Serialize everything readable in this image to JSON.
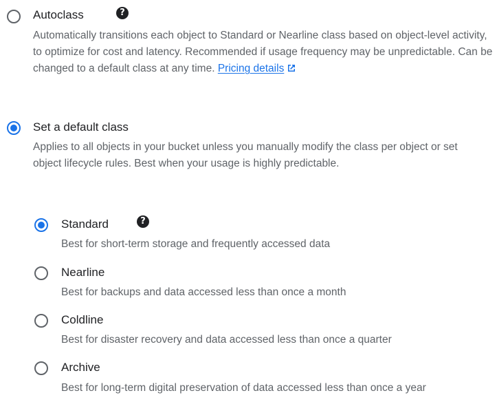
{
  "storage_class": {
    "autoclass": {
      "label": "Autoclass",
      "help_icon": "question-icon",
      "description": "Automatically transitions each object to Standard or Nearline class based on object-level activity, to optimize for cost and latency. Recommended if usage frequency may be unpredictable. Can be changed to a default class at any time. ",
      "link_text": "Pricing details",
      "link_icon": "external-link-icon",
      "selected": false
    },
    "default_class": {
      "label": "Set a default class",
      "description": "Applies to all objects in your bucket unless you manually modify the class per object or set object lifecycle rules. Best when your usage is highly predictable.",
      "selected": true,
      "classes": [
        {
          "label": "Standard",
          "description": "Best for short-term storage and frequently accessed data",
          "selected": true,
          "help_icon": "question-icon"
        },
        {
          "label": "Nearline",
          "description": "Best for backups and data accessed less than once a month",
          "selected": false
        },
        {
          "label": "Coldline",
          "description": "Best for disaster recovery and data accessed less than once a quarter",
          "selected": false
        },
        {
          "label": "Archive",
          "description": "Best for long-term digital preservation of data accessed less than once a year",
          "selected": false
        }
      ]
    }
  },
  "colors": {
    "accent": "#1a73e8",
    "text_primary": "#202124",
    "text_secondary": "#5f6368"
  }
}
